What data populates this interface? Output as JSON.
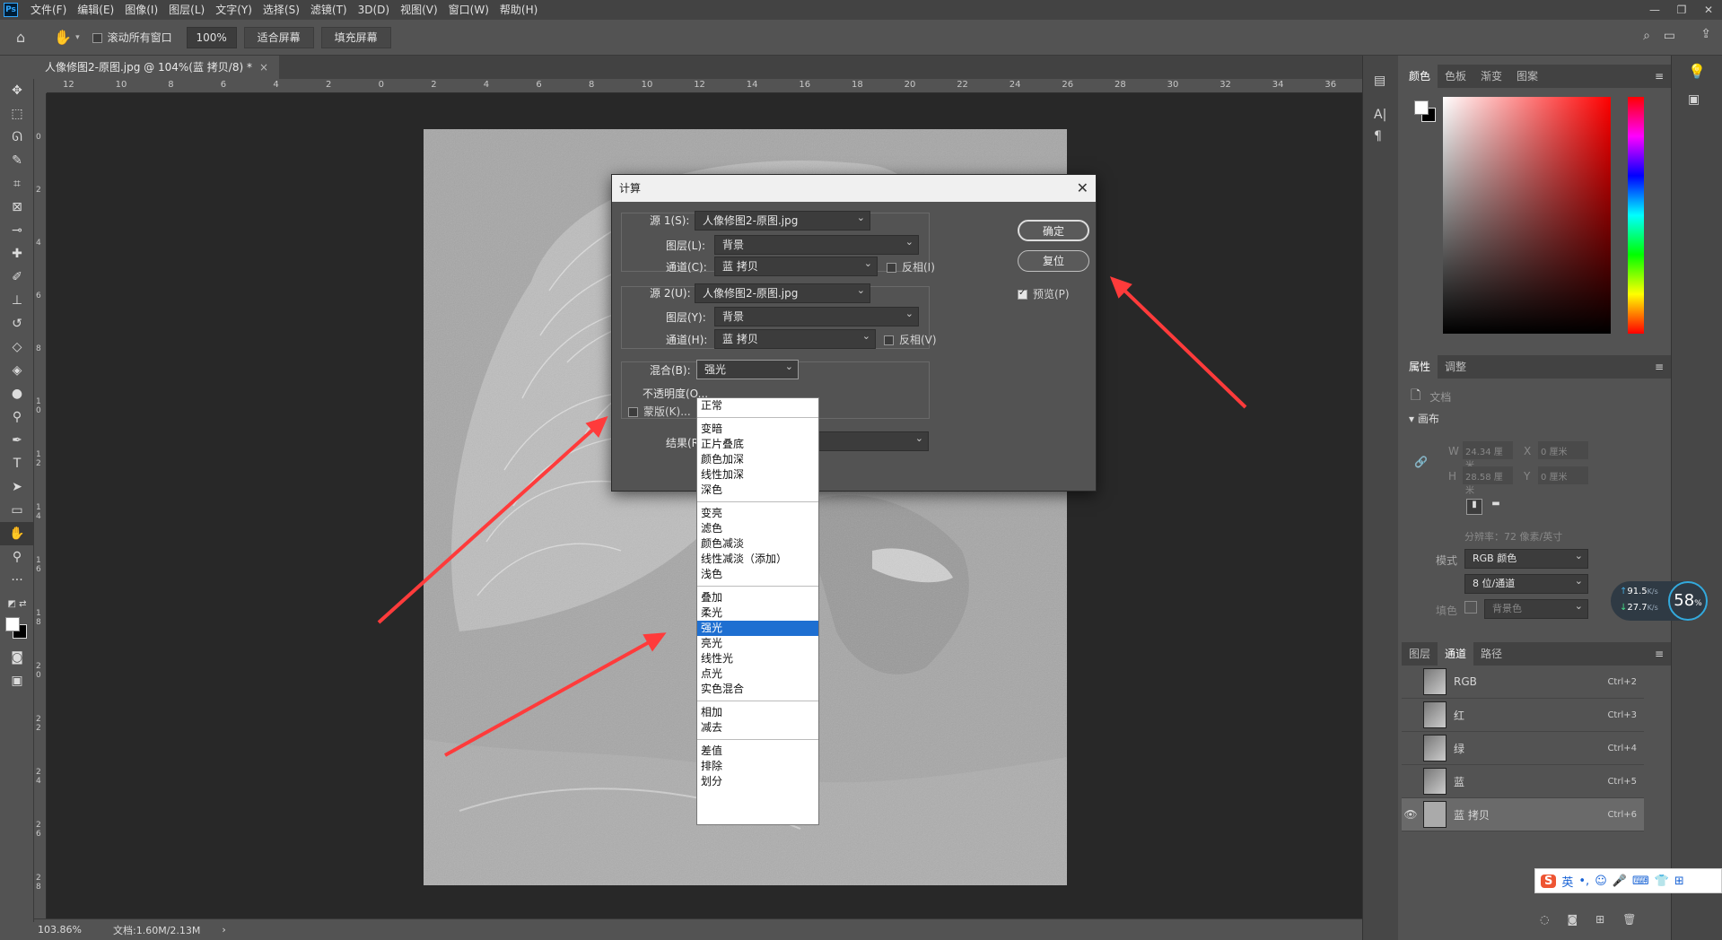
{
  "menu": [
    "文件(F)",
    "编辑(E)",
    "图像(I)",
    "图层(L)",
    "文字(Y)",
    "选择(S)",
    "滤镜(T)",
    "3D(D)",
    "视图(V)",
    "窗口(W)",
    "帮助(H)"
  ],
  "options": {
    "scroll_all": "滚动所有窗口",
    "zoom": "100%",
    "fit": "适合屏幕",
    "fill": "填充屏幕"
  },
  "doc_tab": "人像修图2-原图.jpg @ 104%(蓝 拷贝/8) *",
  "ruler_h": [
    "12",
    "10",
    "8",
    "6",
    "4",
    "2",
    "0",
    "2",
    "4",
    "6",
    "8",
    "10",
    "12",
    "14",
    "16",
    "18",
    "20",
    "22",
    "24",
    "26",
    "28",
    "30",
    "32",
    "34",
    "36"
  ],
  "ruler_v": [
    "0",
    "2",
    "4",
    "6",
    "8",
    "1 0",
    "1 2",
    "1 4",
    "1 6",
    "1 8",
    "2 0",
    "2 2",
    "2 4",
    "2 6",
    "2 8"
  ],
  "status": {
    "zoom": "103.86%",
    "doc": "文档:1.60M/2.13M"
  },
  "color_panel": {
    "tabs": [
      "颜色",
      "色板",
      "渐变",
      "图案"
    ]
  },
  "props": {
    "tabs": [
      "属性",
      "调整"
    ],
    "doc": "文档",
    "canvas": "画布",
    "w_label": "W",
    "w_value": "24.34 厘米",
    "x_label": "X",
    "x_value": "0 厘米",
    "h_label": "H",
    "h_value": "28.58 厘米",
    "y_label": "Y",
    "y_value": "0 厘米",
    "resolution": "分辨率：72 像素/英寸",
    "mode_label": "模式",
    "mode": "RGB 颜色",
    "depth": "8 位/通道",
    "fill_label": "填色",
    "fill": "背景色"
  },
  "channels": {
    "tabs": [
      "图层",
      "通道",
      "路径"
    ],
    "rows": [
      {
        "name": "RGB",
        "key": "Ctrl+2"
      },
      {
        "name": "红",
        "key": "Ctrl+3"
      },
      {
        "name": "绿",
        "key": "Ctrl+4"
      },
      {
        "name": "蓝",
        "key": "Ctrl+5"
      },
      {
        "name": "蓝 拷贝",
        "key": "Ctrl+6"
      }
    ]
  },
  "speed": {
    "up": "91.5",
    "down": "27.7",
    "unit": "K/s",
    "pct": "58",
    "pct_sym": "%"
  },
  "ime": {
    "logo": "S",
    "lang": "英"
  },
  "dialog": {
    "title": "计算",
    "src1_label": "源 1(S):",
    "src1": "人像修图2-原图.jpg",
    "layer1_label": "图层(L):",
    "layer1": "背景",
    "chan1_label": "通道(C):",
    "chan1": "蓝 拷贝",
    "inv1": "反相(I)",
    "src2_label": "源 2(U):",
    "src2": "人像修图2-原图.jpg",
    "layer2_label": "图层(Y):",
    "layer2": "背景",
    "chan2_label": "通道(H):",
    "chan2": "蓝 拷贝",
    "inv2": "反相(V)",
    "blend_label": "混合(B):",
    "blend": "强光",
    "opacity_label": "不透明度(O...",
    "mask_label": "蒙版(K)...",
    "result_label": "结果(R):",
    "ok": "确定",
    "reset": "复位",
    "preview": "预览(P)"
  },
  "blend_groups": [
    [
      "正常"
    ],
    [
      "变暗",
      "正片叠底",
      "颜色加深",
      "线性加深",
      "深色"
    ],
    [
      "变亮",
      "滤色",
      "颜色减淡",
      "线性减淡（添加）",
      "浅色"
    ],
    [
      "叠加",
      "柔光",
      "强光",
      "亮光",
      "线性光",
      "点光",
      "实色混合"
    ],
    [
      "相加",
      "减去"
    ],
    [
      "差值",
      "排除",
      "划分"
    ]
  ],
  "blend_selected": "强光"
}
